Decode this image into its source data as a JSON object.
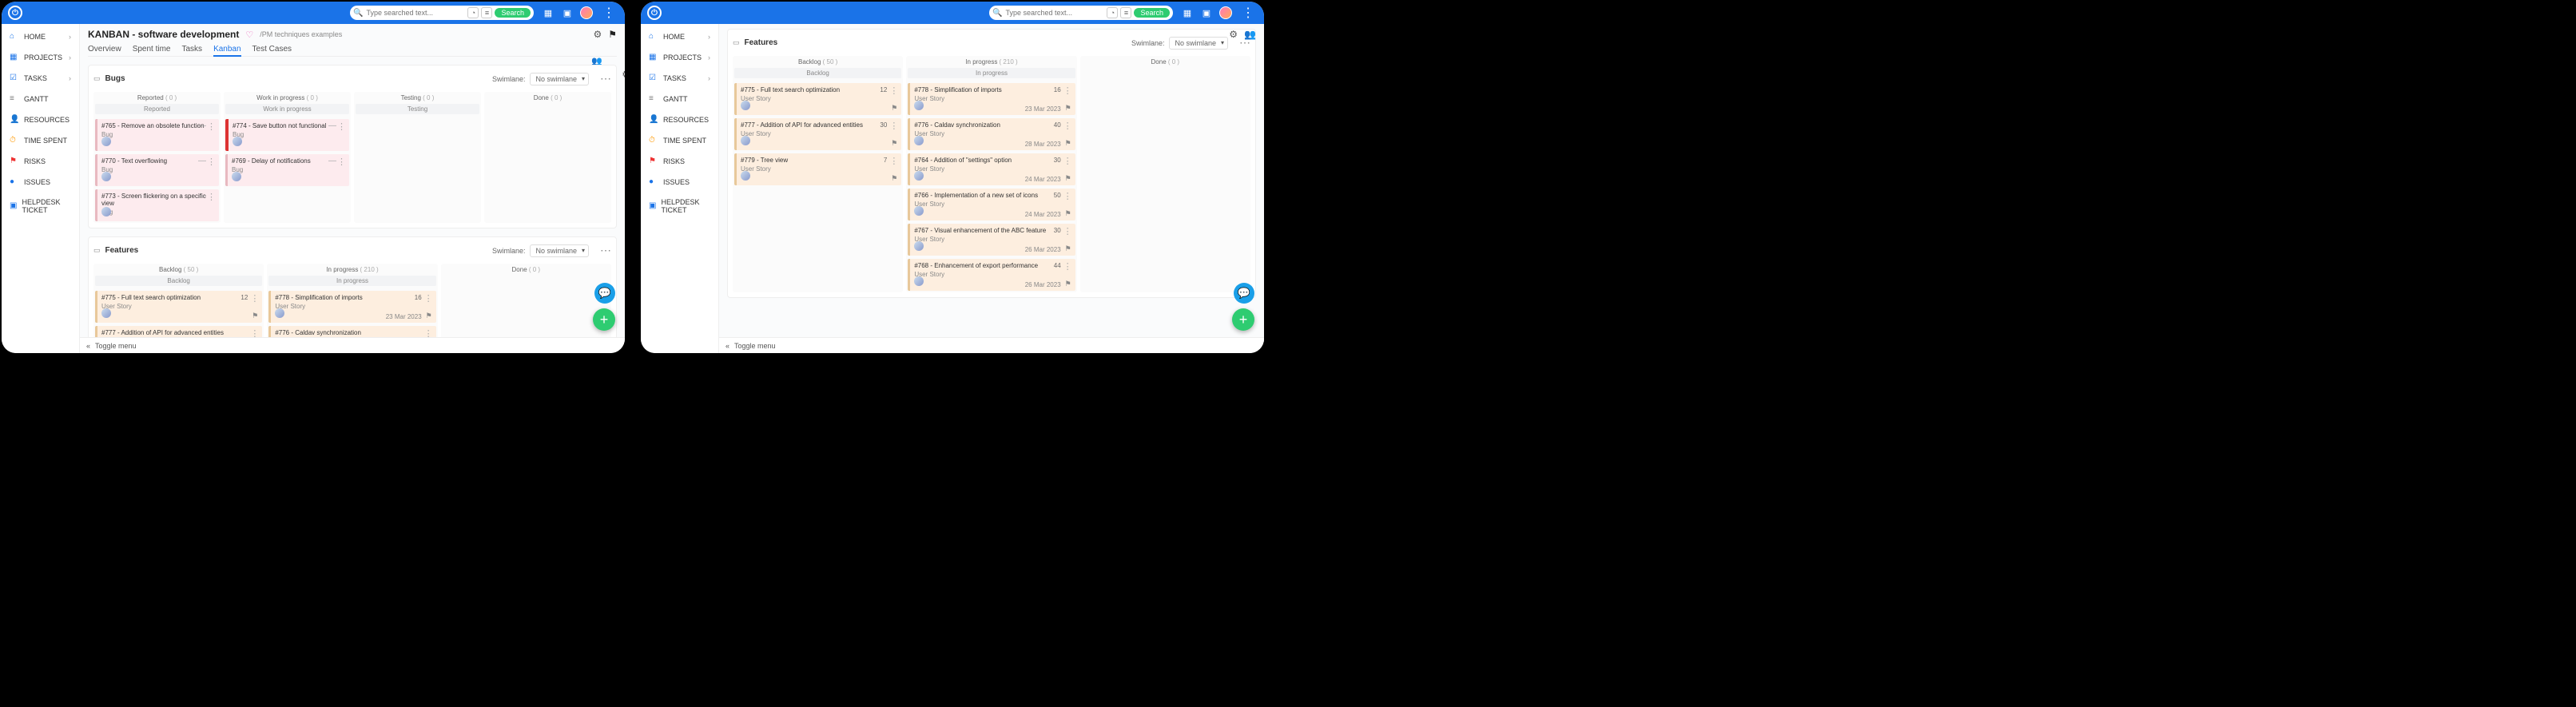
{
  "topbar": {
    "search_placeholder": "Type searched text...",
    "search_button": "Search"
  },
  "sidebar": {
    "items": [
      {
        "icon": "⌂",
        "label": "HOME",
        "expand": true,
        "cls": "blue"
      },
      {
        "icon": "▦",
        "label": "PROJECTS",
        "expand": true,
        "cls": "blue"
      },
      {
        "icon": "☑",
        "label": "TASKS",
        "expand": true,
        "cls": "blue"
      },
      {
        "icon": "≡",
        "label": "GANTT",
        "expand": false,
        "cls": "gray"
      },
      {
        "icon": "👤",
        "label": "RESOURCES",
        "expand": false,
        "cls": "blue"
      },
      {
        "icon": "⏱",
        "label": "TIME SPENT",
        "expand": false,
        "cls": "orange"
      },
      {
        "icon": "⚑",
        "label": "RISKS",
        "expand": false,
        "cls": "red"
      },
      {
        "icon": "●",
        "label": "ISSUES",
        "expand": false,
        "cls": "blue"
      },
      {
        "icon": "▣",
        "label": "HELPDESK TICKET",
        "expand": false,
        "cls": "blue"
      }
    ]
  },
  "page_left": {
    "title": "KANBAN - software development",
    "crumb": "/PM techniques examples",
    "tabs": [
      "Overview",
      "Spent time",
      "Tasks",
      "Kanban",
      "Test Cases"
    ],
    "active_tab": "Kanban"
  },
  "swimlane_label": "Swimlane:",
  "swimlane_value": "No swimlane",
  "bugs_section": {
    "name": "Bugs",
    "columns": [
      {
        "head": "Reported",
        "count": "( 0 )",
        "sub": "Reported"
      },
      {
        "head": "Work in progress",
        "count": "( 0 )",
        "sub": "Work in progress"
      },
      {
        "head": "Testing",
        "count": "( 0 )",
        "sub": "Testing"
      },
      {
        "head": "Done",
        "count": "( 0 )",
        "sub": ""
      }
    ],
    "reported": [
      {
        "t": "#765 - Remove an obsolete function",
        "ty": "Bug"
      },
      {
        "t": "#770 - Text overflowing",
        "ty": "Bug"
      },
      {
        "t": "#773 - Screen flickering on a specific view",
        "ty": "Bug"
      }
    ],
    "wip": [
      {
        "t": "#774 - Save button not functional",
        "ty": "Bug",
        "hl": true
      },
      {
        "t": "#769 - Delay of notifications",
        "ty": "Bug"
      }
    ]
  },
  "features_section_left": {
    "name": "Features",
    "columns": [
      {
        "head": "Backlog",
        "count": "( 50 )",
        "sub": "Backlog"
      },
      {
        "head": "In progress",
        "count": "( 210 )",
        "sub": "In progress"
      },
      {
        "head": "Done",
        "count": "( 0 )",
        "sub": ""
      }
    ],
    "backlog": [
      {
        "t": "#775 - Full text search optimization",
        "ty": "User Story",
        "n": "12"
      },
      {
        "t": "#777 - Addition of API for advanced entities",
        "ty": "User Story"
      }
    ],
    "inprog": [
      {
        "t": "#778 - Simplification of imports",
        "ty": "User Story",
        "n": "16",
        "d": "23 Mar 2023"
      },
      {
        "t": "#776 - Caldav synchronization",
        "ty": "User Story"
      }
    ]
  },
  "features_section_right": {
    "name": "Features",
    "columns": [
      {
        "head": "Backlog",
        "count": "( 50 )",
        "sub": "Backlog"
      },
      {
        "head": "In progress",
        "count": "( 210 )",
        "sub": "In progress"
      },
      {
        "head": "Done",
        "count": "( 0 )",
        "sub": ""
      }
    ],
    "backlog": [
      {
        "t": "#775 - Full text search optimization",
        "ty": "User Story",
        "n": "12"
      },
      {
        "t": "#777 - Addition of API for advanced entities",
        "ty": "User Story",
        "n": "30"
      },
      {
        "t": "#779 - Tree view",
        "ty": "User Story",
        "n": "7"
      }
    ],
    "inprog": [
      {
        "t": "#778 - Simplification of imports",
        "ty": "User Story",
        "n": "16",
        "d": "23 Mar 2023"
      },
      {
        "t": "#776 - Caldav synchronization",
        "ty": "User Story",
        "n": "40",
        "d": "28 Mar 2023"
      },
      {
        "t": "#764 - Addition of \"settings\" option",
        "ty": "User Story",
        "n": "30",
        "d": "24 Mar 2023"
      },
      {
        "t": "#766 - Implementation of a new set of icons",
        "ty": "User Story",
        "n": "50",
        "d": "24 Mar 2023"
      },
      {
        "t": "#767 - Visual enhancement of the ABC feature",
        "ty": "User Story",
        "n": "30",
        "d": "26 Mar 2023"
      },
      {
        "t": "#768 - Enhancement of export performance",
        "ty": "User Story",
        "n": "44",
        "d": "26 Mar 2023"
      }
    ]
  },
  "footer": {
    "toggle": "Toggle menu"
  }
}
